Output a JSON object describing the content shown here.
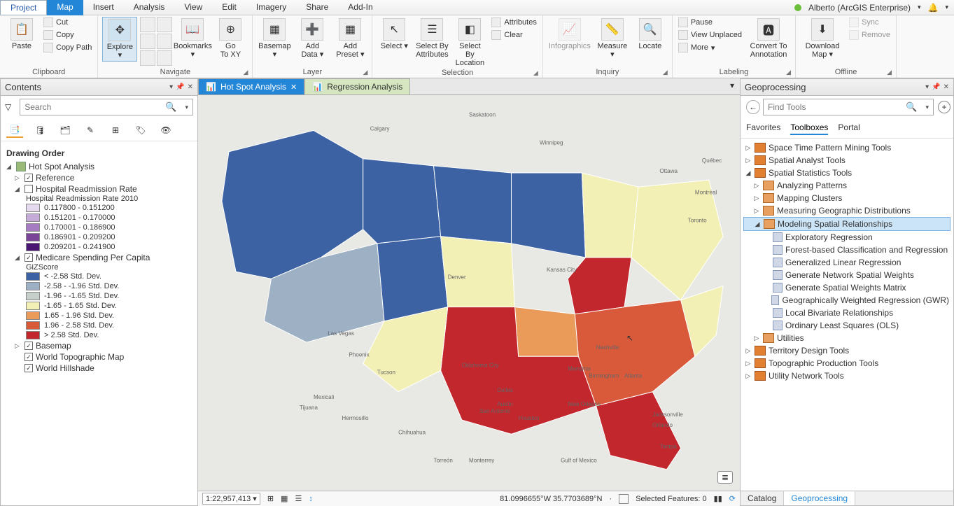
{
  "menu": [
    "Project",
    "Map",
    "Insert",
    "Analysis",
    "View",
    "Edit",
    "Imagery",
    "Share",
    "Add-In"
  ],
  "user": "Alberto (ArcGIS Enterprise)",
  "ribbon": {
    "clipboard": {
      "label": "Clipboard",
      "paste": "Paste",
      "cut": "Cut",
      "copy": "Copy",
      "copypath": "Copy Path"
    },
    "navigate": {
      "label": "Navigate",
      "explore": "Explore",
      "bookmarks": "Bookmarks",
      "goto": "Go\nTo XY"
    },
    "layer": {
      "label": "Layer",
      "basemap": "Basemap",
      "adddata": "Add\nData",
      "addpreset": "Add\nPreset"
    },
    "selection": {
      "label": "Selection",
      "select": "Select",
      "selattr": "Select By\nAttributes",
      "selloc": "Select By\nLocation",
      "attributes": "Attributes",
      "clear": "Clear"
    },
    "inquiry": {
      "label": "Inquiry",
      "infographics": "Infographics",
      "measure": "Measure",
      "locate": "Locate"
    },
    "labeling": {
      "label": "Labeling",
      "pause": "Pause",
      "unplaced": "View Unplaced",
      "more": "More",
      "convert": "Convert To\nAnnotation"
    },
    "offline": {
      "label": "Offline",
      "download": "Download\nMap",
      "sync": "Sync",
      "remove": "Remove"
    }
  },
  "contents": {
    "title": "Contents",
    "search_placeholder": "Search",
    "drawing_order": "Drawing Order",
    "layers": {
      "hotspot": "Hot Spot Analysis",
      "reference": "Reference",
      "hospital": "Hospital Readmission Rate",
      "hospital_title": "Hospital Readmission Rate 2010",
      "hospital_classes": [
        {
          "c": "#e5d9ed",
          "l": "0.117800 - 0.151200"
        },
        {
          "c": "#c5abd7",
          "l": "0.151201 - 0.170000"
        },
        {
          "c": "#a57cc2",
          "l": "0.170001 - 0.186900"
        },
        {
          "c": "#7a4598",
          "l": "0.186901 - 0.209200"
        },
        {
          "c": "#4a1772",
          "l": "0.209201 - 0.241900"
        }
      ],
      "medicare": "Medicare Spending Per Capita",
      "gizscore": "GiZScore",
      "giz_classes": [
        {
          "c": "#3c62a3",
          "l": "< -2.58 Std. Dev."
        },
        {
          "c": "#9eb1c4",
          "l": "-2.58 - -1.96 Std. Dev."
        },
        {
          "c": "#c6cfc9",
          "l": "-1.96 - -1.65 Std. Dev."
        },
        {
          "c": "#f3f0b6",
          "l": "-1.65 - 1.65 Std. Dev."
        },
        {
          "c": "#ea9a59",
          "l": "1.65 - 1.96 Std. Dev."
        },
        {
          "c": "#d85a3a",
          "l": "1.96 - 2.58 Std. Dev."
        },
        {
          "c": "#c1272d",
          "l": "> 2.58 Std. Dev."
        }
      ],
      "basemap": "Basemap",
      "topo": "World Topographic Map",
      "hillshade": "World Hillshade"
    }
  },
  "maptabs": {
    "hotspot": "Hot Spot Analysis",
    "regression": "Regression Analysis"
  },
  "status": {
    "scale": "1:22,957,413",
    "coords": "81.0996655°W 35.7703689°N",
    "selected": "Selected Features: 0"
  },
  "geo": {
    "title": "Geoprocessing",
    "find": "Find Tools",
    "tabs": [
      "Favorites",
      "Toolboxes",
      "Portal"
    ],
    "toolboxes": [
      "Space Time Pattern Mining Tools",
      "Spatial Analyst Tools",
      "Spatial Statistics Tools"
    ],
    "sst_sets": [
      "Analyzing Patterns",
      "Mapping Clusters",
      "Measuring Geographic Distributions",
      "Modeling Spatial Relationships"
    ],
    "msr_tools": [
      "Exploratory Regression",
      "Forest-based Classification and Regression",
      "Generalized Linear Regression",
      "Generate Network Spatial Weights",
      "Generate Spatial Weights Matrix",
      "Geographically Weighted Regression (GWR)",
      "Local Bivariate Relationships",
      "Ordinary Least Squares (OLS)"
    ],
    "utilities": "Utilities",
    "more_tbx": [
      "Territory Design Tools",
      "Topographic Production Tools",
      "Utility Network Tools"
    ]
  },
  "footer": [
    "Catalog",
    "Geoprocessing"
  ]
}
